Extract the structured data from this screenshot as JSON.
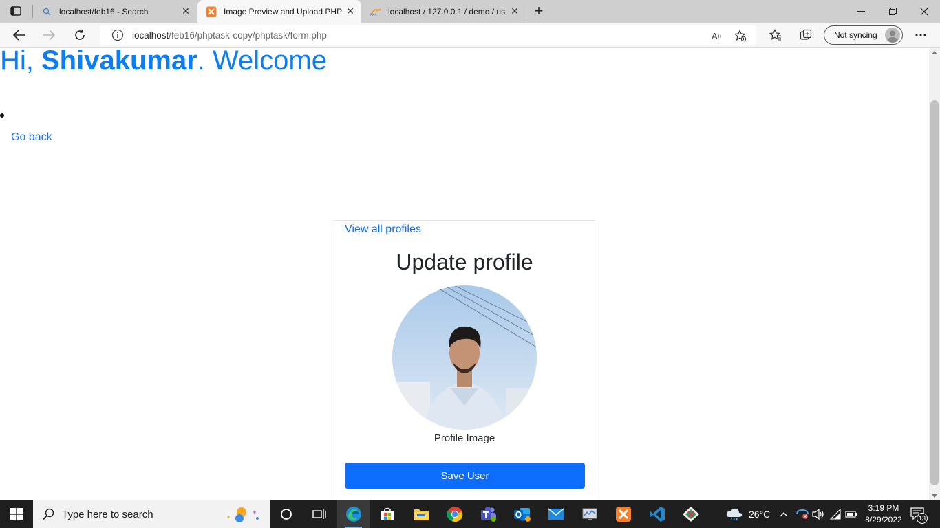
{
  "browser": {
    "tabs": [
      {
        "title": "localhost/feb16 - Search",
        "favicon": "search-icon"
      },
      {
        "title": "Image Preview and Upload PHP",
        "favicon": "xampp-icon",
        "active": true
      },
      {
        "title": "localhost / 127.0.0.1 / demo / us",
        "favicon": "phpmyadmin-icon"
      }
    ],
    "url_host": "localhost",
    "url_path": "/feb16/phptask-copy/phptask/form.php",
    "sync_label": "Not syncing"
  },
  "page": {
    "greeting_prefix": "Hi, ",
    "user_name": "Shivakumar",
    "greeting_suffix": ". Welcome",
    "go_back": "Go back",
    "link_color": "#0d6efd",
    "heading_color": "#0d7ef0"
  },
  "card": {
    "view_all": "View all profiles",
    "title": "Update profile",
    "image_label": "Profile Image",
    "save_button": "Save User",
    "button_color": "#0d6efd"
  },
  "taskbar": {
    "search_placeholder": "Type here to search",
    "weather": "26°C",
    "time": "3:19 PM",
    "date": "8/29/2022",
    "notification_count": "13"
  }
}
